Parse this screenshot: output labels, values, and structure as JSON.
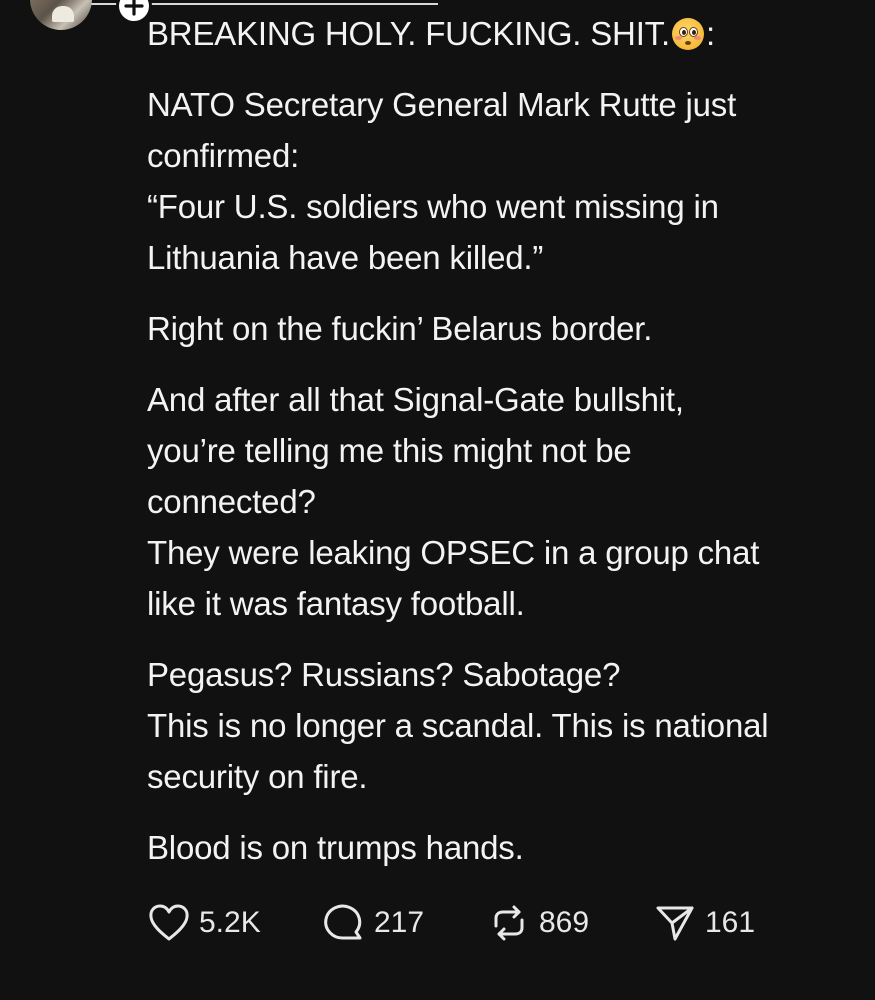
{
  "post": {
    "headline": "BREAKING HOLY. FUCKING. SHIT.",
    "headline_suffix": ":",
    "emoji_icon": "flushed-face-emoji",
    "paragraphs": [
      [
        "NATO Secretary General Mark Rutte just",
        "confirmed:",
        "“Four U.S. soldiers who went missing in",
        "Lithuania have been killed.”"
      ],
      [
        "Right on the fuckin’ Belarus border."
      ],
      [
        "And after all that Signal-Gate bullshit,",
        "you’re telling me this might not be",
        "connected?",
        "They were leaking OPSEC in a group chat",
        "like it was fantasy football."
      ],
      [
        "Pegasus? Russians? Sabotage?",
        "This is no longer a scandal. This is national",
        "security on fire."
      ],
      [
        "Blood is on trumps hands."
      ]
    ]
  },
  "actions": {
    "likes": "5.2K",
    "replies": "217",
    "reposts": "869",
    "shares": "161"
  },
  "icons": {
    "like": "heart-icon",
    "reply": "comment-bubble-icon",
    "repost": "repost-icon",
    "share": "send-icon",
    "follow": "plus-icon"
  },
  "colors": {
    "background": "#111111",
    "text": "#f3f3f3"
  }
}
